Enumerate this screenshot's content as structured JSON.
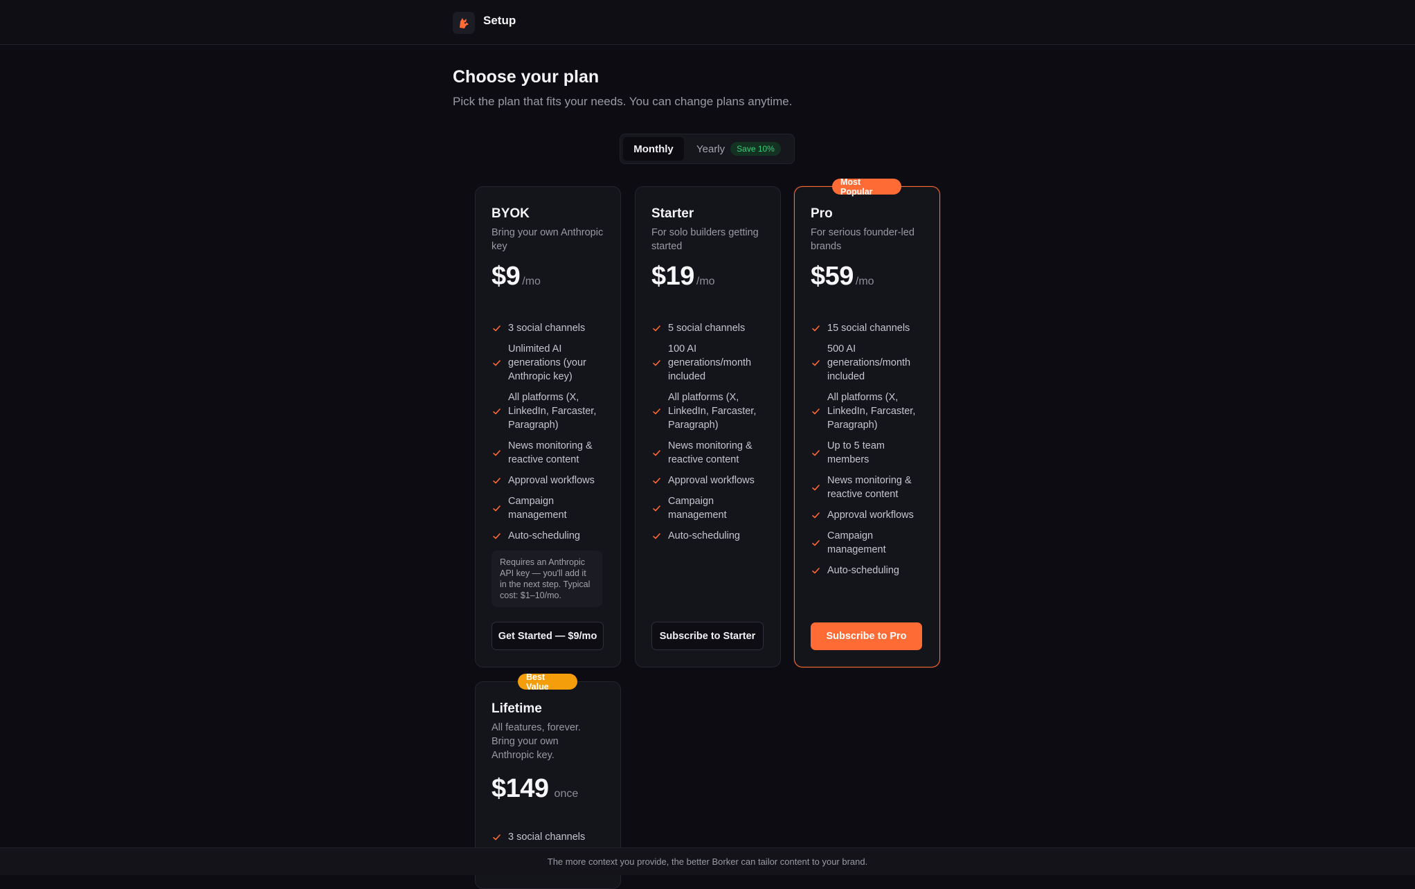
{
  "app": {
    "title": "Setup"
  },
  "header": {
    "title": "Choose your plan",
    "subtitle": "Pick the plan that fits your needs. You can change plans anytime."
  },
  "billing_toggle": {
    "options": [
      "Monthly",
      "Yearly"
    ],
    "selected": "Monthly",
    "yearly_badge": "Save 10%"
  },
  "colors": {
    "accent": "#ff6b35",
    "best_value": "#f59e0b",
    "save_badge": "#34d17a"
  },
  "plans": [
    {
      "name": "BYOK",
      "description": "Bring your own Anthropic key",
      "price": "$9",
      "period": "/mo",
      "features": [
        "3 social channels",
        "Unlimited AI generations (your Anthropic key)",
        "All platforms (X, LinkedIn, Farcaster, Paragraph)",
        "News monitoring & reactive content",
        "Approval workflows",
        "Campaign management",
        "Auto-scheduling"
      ],
      "note": "Requires an Anthropic API key — you'll add it in the next step. Typical cost: $1–10/mo.",
      "button_label": "Get Started — $9/mo"
    },
    {
      "name": "Starter",
      "description": "For solo builders getting started",
      "price": "$19",
      "period": "/mo",
      "features": [
        "5 social channels",
        "100 AI generations/month included",
        "All platforms (X, LinkedIn, Farcaster, Paragraph)",
        "News monitoring & reactive content",
        "Approval workflows",
        "Campaign management",
        "Auto-scheduling"
      ],
      "button_label": "Subscribe to Starter"
    },
    {
      "name": "Pro",
      "ribbon": "Most Popular",
      "description": "For serious founder-led brands",
      "price": "$59",
      "period": "/mo",
      "features": [
        "15 social channels",
        "500 AI generations/month included",
        "All platforms (X, LinkedIn, Farcaster, Paragraph)",
        "Up to 5 team members",
        "News monitoring & reactive content",
        "Approval workflows",
        "Campaign management",
        "Auto-scheduling"
      ],
      "button_label": "Subscribe to Pro"
    },
    {
      "name": "Lifetime",
      "ribbon": "Best Value",
      "description": "All features, forever. Bring your own Anthropic key.",
      "price": "$149",
      "period": "once",
      "features": [
        "3 social channels"
      ]
    }
  ],
  "footer": {
    "text": "The more context you provide, the better Borker can tailor content to your brand."
  }
}
